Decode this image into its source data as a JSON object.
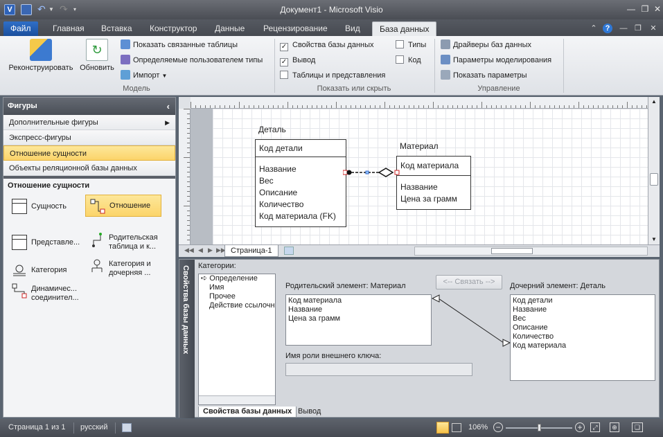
{
  "window": {
    "title": "Документ1 - Microsoft Visio"
  },
  "ribbon": {
    "tabs": [
      {
        "label": "Файл"
      },
      {
        "label": "Главная"
      },
      {
        "label": "Вставка"
      },
      {
        "label": "Конструктор"
      },
      {
        "label": "Данные"
      },
      {
        "label": "Рецензирование"
      },
      {
        "label": "Вид"
      },
      {
        "label": "База данных"
      }
    ],
    "active_tab": "База данных",
    "model_group": {
      "label": "Модель",
      "reconstruct": "Реконструировать",
      "refresh": "Обновить",
      "show_related": "Показать связанные таблицы",
      "user_defined": "Определяемые пользователем типы",
      "import": "Импорт"
    },
    "show_hide_group": {
      "label": "Показать или скрыть",
      "db_properties": "Свойства базы данных",
      "output": "Вывод",
      "tables_views": "Таблицы и представления",
      "types": "Типы",
      "code": "Код"
    },
    "manage_group": {
      "label": "Управление",
      "drivers": "Драйверы баз данных",
      "modeling_params": "Параметры моделирования",
      "show_params": "Показать параметры"
    }
  },
  "shapes_pane": {
    "title": "Фигуры",
    "stencils": [
      {
        "label": "Дополнительные фигуры"
      },
      {
        "label": "Экспресс-фигуры"
      },
      {
        "label": "Отношение сущности"
      },
      {
        "label": "Объекты реляционной базы данных"
      }
    ],
    "section_title": "Отношение сущности",
    "shapes": [
      {
        "label": "Сущность"
      },
      {
        "label": "Отношение"
      },
      {
        "label": "Представле..."
      },
      {
        "label": "Родительская таблица и к..."
      },
      {
        "label": "Категория"
      },
      {
        "label": "Категория и дочерняя ..."
      },
      {
        "label": "Динамичес... соединител..."
      }
    ]
  },
  "diagram": {
    "entity_detail": {
      "name": "Деталь",
      "pk": "Код детали",
      "fields": [
        "Название",
        "Вес",
        "Описание",
        "Количество",
        "Код материала (FK)"
      ]
    },
    "entity_material": {
      "name": "Материал",
      "pk": "Код материала",
      "fields": [
        "Название",
        "Цена за грамм"
      ]
    },
    "page_tab": "Страница-1"
  },
  "properties": {
    "window_title": "Свойства базы данных",
    "categories_label": "Категории:",
    "categories": [
      "Определение",
      "Имя",
      "Прочее",
      "Действие ссылочн"
    ],
    "parent_label": "Родительский элемент: Материал",
    "parent_items": [
      "Код материала",
      "Название",
      "Цена за грамм"
    ],
    "link_button": "<-- Связать -->",
    "child_label": "Дочерний элемент: Деталь",
    "child_items": [
      "Код детали",
      "Название",
      "Вес",
      "Описание",
      "Количество",
      "Код материала"
    ],
    "fk_role_label": "Имя роли внешнего ключа:",
    "tabs": [
      {
        "label": "Свойства базы данных"
      },
      {
        "label": "Вывод"
      }
    ]
  },
  "status": {
    "page": "Страница 1 из 1",
    "language": "русский",
    "zoom": "106%"
  }
}
